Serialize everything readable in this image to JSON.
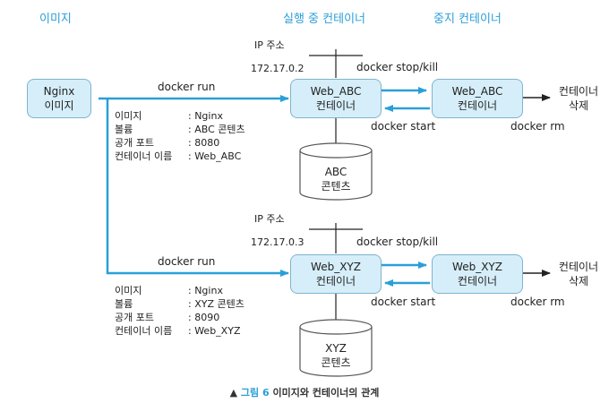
{
  "headers": {
    "image": "이미지",
    "running": "실행 중 컨테이너",
    "stopped": "중지 컨테이너"
  },
  "image_box": {
    "line1": "Nginx",
    "line2": "이미지"
  },
  "top": {
    "ip_label": "IP 주소",
    "ip_value": "172.17.0.2",
    "run_label": "docker run",
    "running_box": {
      "line1": "Web_ABC",
      "line2": "컨테이너"
    },
    "stopped_box": {
      "line1": "Web_ABC",
      "line2": "컨테이너"
    },
    "stop_label": "docker stop/kill",
    "start_label": "docker start",
    "rm_label": "docker rm",
    "delete_label": {
      "line1": "컨테이너",
      "line2": "삭제"
    },
    "volume": {
      "line1": "ABC",
      "line2": "콘텐츠"
    },
    "info": [
      {
        "key": "이미지",
        "value": ": Nginx"
      },
      {
        "key": "볼륨",
        "value": ": ABC 콘텐츠"
      },
      {
        "key": "공개 포트",
        "value": ": 8080"
      },
      {
        "key": "컨테이너 이름",
        "value": ": Web_ABC"
      }
    ]
  },
  "bottom": {
    "ip_label": "IP 주소",
    "ip_value": "172.17.0.3",
    "run_label": "docker run",
    "running_box": {
      "line1": "Web_XYZ",
      "line2": "컨테이너"
    },
    "stopped_box": {
      "line1": "Web_XYZ",
      "line2": "컨테이너"
    },
    "stop_label": "docker stop/kill",
    "start_label": "docker start",
    "rm_label": "docker rm",
    "delete_label": {
      "line1": "컨테이너",
      "line2": "삭제"
    },
    "volume": {
      "line1": "XYZ",
      "line2": "콘텐츠"
    },
    "info": [
      {
        "key": "이미지",
        "value": ": Nginx"
      },
      {
        "key": "볼륨",
        "value": ": XYZ 콘텐츠"
      },
      {
        "key": "공개 포트",
        "value": ": 8090"
      },
      {
        "key": "컨테이너 이름",
        "value": ": Web_XYZ"
      }
    ]
  },
  "caption": {
    "marker": "▲",
    "figure": "그림 6",
    "text": "이미지와 컨테이너의 관계"
  },
  "colors": {
    "accent": "#2a9fd8",
    "box_fill": "#d6eef9",
    "box_border": "#7fb4cf"
  }
}
